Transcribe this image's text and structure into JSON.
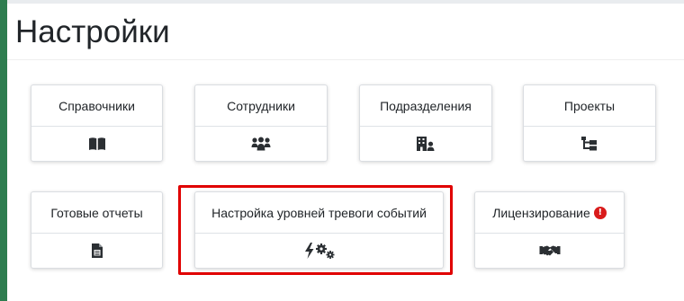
{
  "page": {
    "title": "Настройки"
  },
  "cards": {
    "directories": {
      "label": "Справочники",
      "icon": "book-icon"
    },
    "employees": {
      "label": "Сотрудники",
      "icon": "users-icon"
    },
    "departments": {
      "label": "Подразделения",
      "icon": "building-user-icon"
    },
    "projects": {
      "label": "Проекты",
      "icon": "sitemap-icon"
    },
    "reports": {
      "label": "Готовые отчеты",
      "icon": "file-report-icon"
    },
    "alarm_levels": {
      "label": "Настройка уровней тревоги событий",
      "icon": "bolt-gears-icon"
    },
    "licensing": {
      "label": "Лицензирование",
      "icon": "handshake-icon",
      "badge": "!"
    }
  },
  "colors": {
    "accent_green": "#2e7d4f",
    "highlight_red": "#e00000",
    "badge_red": "#d91b1b",
    "icon_dark": "#2b2f33"
  }
}
